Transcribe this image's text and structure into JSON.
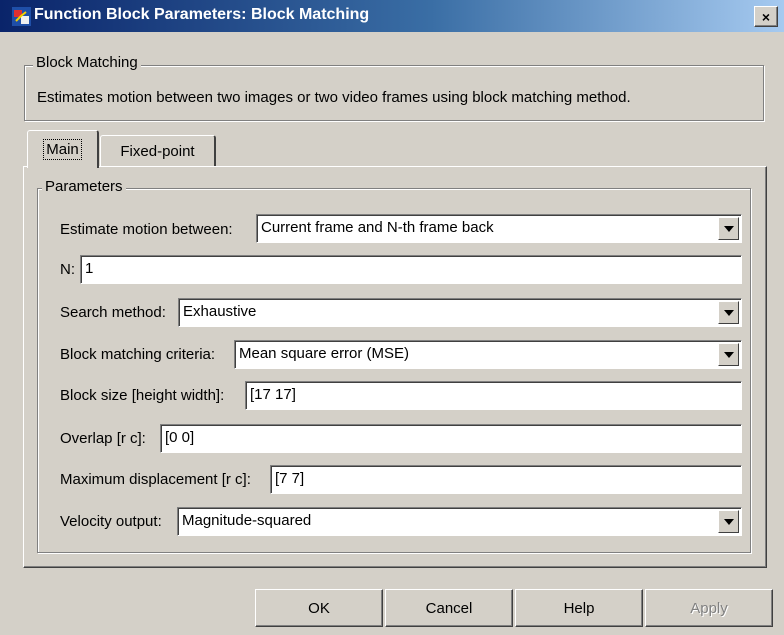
{
  "window": {
    "title": "Function Block Parameters: Block Matching",
    "close_glyph": "×",
    "icon": "simulink-block-icon"
  },
  "block": {
    "group_title": "Block Matching",
    "description": "Estimates motion between two images or two video frames using block matching method."
  },
  "tabs": [
    {
      "label": "Main",
      "selected": true
    },
    {
      "label": "Fixed-point",
      "selected": false
    }
  ],
  "parameters": {
    "group_title": "Parameters",
    "estimate_motion": {
      "label": "Estimate motion between:",
      "value": "Current frame and N-th frame back"
    },
    "n": {
      "label": "N:",
      "value": "1"
    },
    "search_method": {
      "label": "Search method:",
      "value": "Exhaustive"
    },
    "criteria": {
      "label": "Block matching criteria:",
      "value": "Mean square error (MSE)"
    },
    "block_size": {
      "label": "Block size [height width]:",
      "value": "[17 17]"
    },
    "overlap": {
      "label": "Overlap [r c]:",
      "value": "[0 0]"
    },
    "max_displacement": {
      "label": "Maximum displacement [r c]:",
      "value": "[7 7]"
    },
    "velocity_output": {
      "label": "Velocity output:",
      "value": "Magnitude-squared"
    }
  },
  "buttons": {
    "ok": "OK",
    "cancel": "Cancel",
    "help": "Help",
    "apply": "Apply"
  },
  "colors": {
    "dialog_bg": "#d4d0c8",
    "titlebar_start": "#0a246a",
    "titlebar_end": "#a6caf0",
    "disabled_text": "#808080"
  }
}
